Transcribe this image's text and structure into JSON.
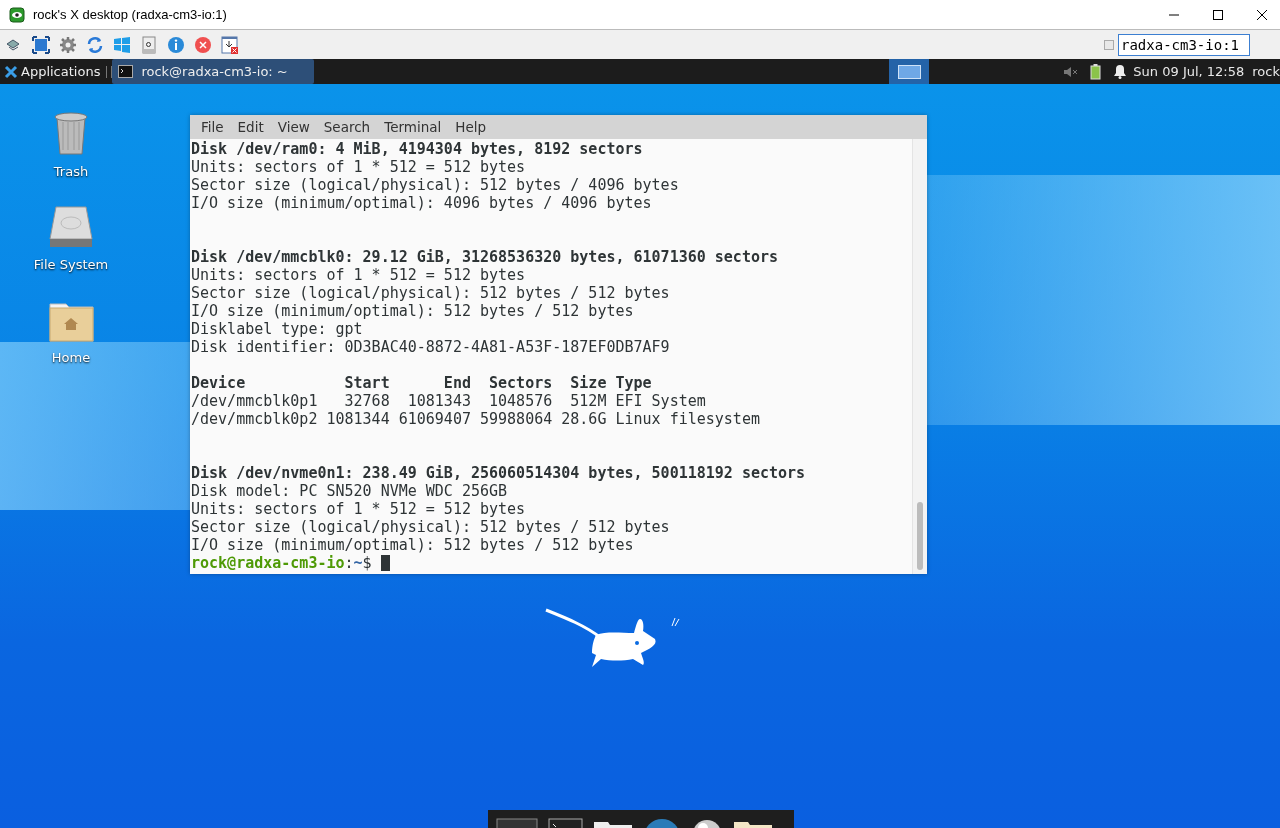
{
  "window": {
    "title": "rock's X desktop (radxa-cm3-io:1)"
  },
  "toolbar": {
    "host_field": {
      "value": "radxa-cm3-io:1"
    }
  },
  "panel": {
    "applications": "Applications",
    "tasks": [
      {
        "label": "rock@radxa-cm3-io: ~",
        "selected": true
      }
    ],
    "clock": "Sun 09 Jul, 12:58",
    "user": "rock"
  },
  "desktop_icons": [
    {
      "label": "Trash",
      "kind": "trash"
    },
    {
      "label": "File System",
      "kind": "drive"
    },
    {
      "label": "Home",
      "kind": "home"
    }
  ],
  "terminal": {
    "menu": [
      "File",
      "Edit",
      "View",
      "Search",
      "Terminal",
      "Help"
    ],
    "lines": [
      {
        "kind": "bold",
        "text": "Disk /dev/ram0: 4 MiB, 4194304 bytes, 8192 sectors"
      },
      {
        "kind": "normal",
        "text": "Units: sectors of 1 * 512 = 512 bytes"
      },
      {
        "kind": "normal",
        "text": "Sector size (logical/physical): 512 bytes / 4096 bytes"
      },
      {
        "kind": "normal",
        "text": "I/O size (minimum/optimal): 4096 bytes / 4096 bytes"
      },
      {
        "kind": "blank"
      },
      {
        "kind": "blank"
      },
      {
        "kind": "bold",
        "text": "Disk /dev/mmcblk0: 29.12 GiB, 31268536320 bytes, 61071360 sectors"
      },
      {
        "kind": "normal",
        "text": "Units: sectors of 1 * 512 = 512 bytes"
      },
      {
        "kind": "normal",
        "text": "Sector size (logical/physical): 512 bytes / 512 bytes"
      },
      {
        "kind": "normal",
        "text": "I/O size (minimum/optimal): 512 bytes / 512 bytes"
      },
      {
        "kind": "normal",
        "text": "Disklabel type: gpt"
      },
      {
        "kind": "normal",
        "text": "Disk identifier: 0D3BAC40-8872-4A81-A53F-187EF0DB7AF9"
      },
      {
        "kind": "blank"
      },
      {
        "kind": "bold",
        "text": "Device           Start      End  Sectors  Size Type"
      },
      {
        "kind": "normal",
        "text": "/dev/mmcblk0p1   32768  1081343  1048576  512M EFI System"
      },
      {
        "kind": "normal",
        "text": "/dev/mmcblk0p2 1081344 61069407 59988064 28.6G Linux filesystem"
      },
      {
        "kind": "blank"
      },
      {
        "kind": "blank"
      },
      {
        "kind": "bold",
        "text": "Disk /dev/nvme0n1: 238.49 GiB, 256060514304 bytes, 500118192 sectors"
      },
      {
        "kind": "normal",
        "text": "Disk model: PC SN520 NVMe WDC 256GB"
      },
      {
        "kind": "normal",
        "text": "Units: sectors of 1 * 512 = 512 bytes"
      },
      {
        "kind": "normal",
        "text": "Sector size (logical/physical): 512 bytes / 512 bytes"
      },
      {
        "kind": "normal",
        "text": "I/O size (minimum/optimal): 512 bytes / 512 bytes"
      }
    ],
    "prompt": {
      "user_host": "rock@radxa-cm3-io",
      "separator": ":",
      "path": "~",
      "symbol": "$"
    }
  }
}
